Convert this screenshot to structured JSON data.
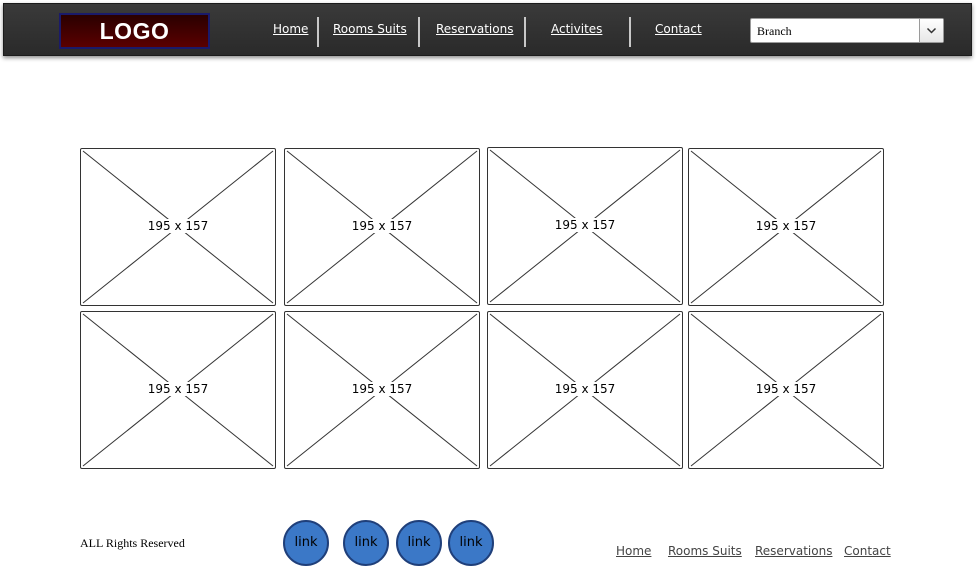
{
  "header": {
    "logo": "LOGO",
    "nav": [
      "Home",
      "Rooms Suits",
      "Reservations",
      "Activites",
      "Contact"
    ],
    "branch_select": {
      "value": "Branch"
    }
  },
  "gallery": {
    "tiles": [
      "195 x 157",
      "195 x 157",
      "195 x 157",
      "195 x 157",
      "195 x 157",
      "195 x 157",
      "195 x 157",
      "195 x 157"
    ]
  },
  "footer": {
    "copyright": "ALL Rights Reserved",
    "circle_links": [
      "link",
      "link",
      "link",
      "link"
    ],
    "links": [
      "Home",
      "Rooms Suits",
      "Reservations",
      "Contact"
    ]
  },
  "colors": {
    "topbar": "#2f2f2f",
    "logo_bg": "#3a0000",
    "circle_link": "#3b78c7"
  }
}
